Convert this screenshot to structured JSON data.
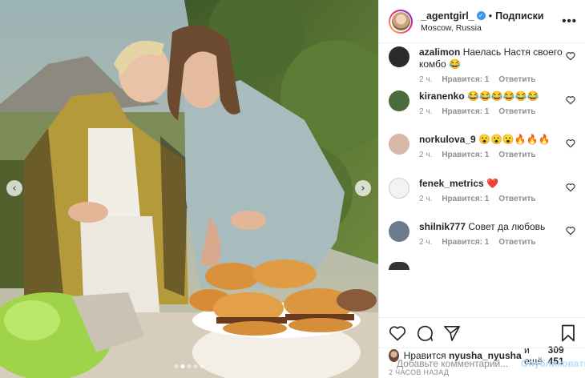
{
  "header": {
    "username": "_agentgirl_",
    "separator": "•",
    "follow_label": "Подписки",
    "location": "Moscow, Russia",
    "more": "•••"
  },
  "media": {
    "slides_total": 5,
    "active_slide": 2
  },
  "comments": [
    {
      "user": "azalimon",
      "text": "Наелась Настя своего комбо 😂",
      "time": "2 ч.",
      "likes": "Нравится: 1",
      "reply": "Ответить",
      "avatar_color": "#2b2b2b"
    },
    {
      "user": "kiranenko",
      "text": "😂😂😂😂😂😂",
      "time": "2 ч.",
      "likes": "Нравится: 1",
      "reply": "Ответить",
      "avatar_color": "#4a6b3a"
    },
    {
      "user": "norkulova_9",
      "text": "😮😮😮🔥🔥🔥",
      "time": "2 ч.",
      "likes": "Нравится: 1",
      "reply": "Ответить",
      "avatar_color": "#d7b7a5"
    },
    {
      "user": "fenek_metrics",
      "text": "❤️",
      "time": "2 ч.",
      "likes": "Нравится: 1",
      "reply": "Ответить",
      "avatar_color": "#f3f3f3"
    },
    {
      "user": "shilnik777",
      "text": "Совет да любовь",
      "time": "2 ч.",
      "likes": "Нравится: 1",
      "reply": "Ответить",
      "avatar_color": "#6b7a8c"
    }
  ],
  "likes": {
    "prefix": "Нравится",
    "user": "nyusha_nyusha",
    "middle": "и ещё",
    "count": "309 451"
  },
  "time_ago": "2 ЧАСОВ НАЗАД",
  "add_comment": {
    "placeholder": "Добавьте комментарий...",
    "publish_label": "Опубликовать"
  },
  "colors": {
    "accent_blue": "#3897f0",
    "publish_disabled": "#b2dffc",
    "heart_red": "#ed4956"
  }
}
